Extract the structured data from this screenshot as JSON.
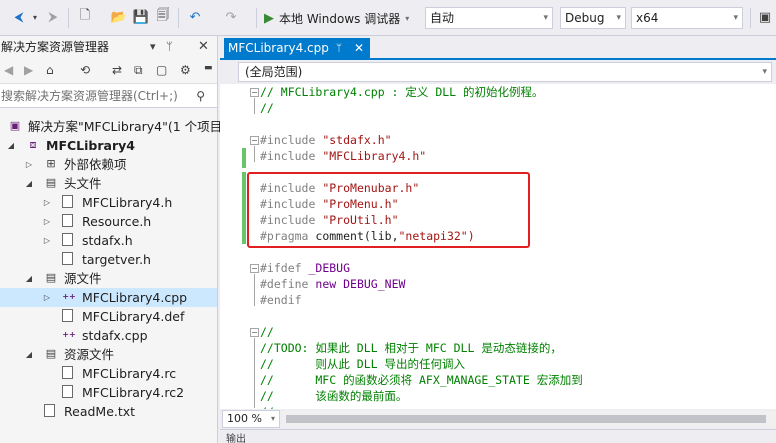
{
  "toolbar": {
    "run_label": "本地 Windows 调试器",
    "config_value": "自动",
    "build_config": "Debug",
    "platform": "x64"
  },
  "solution_explorer": {
    "title": "解决方案资源管理器",
    "search_placeholder": "搜索解决方案资源管理器(Ctrl+;)",
    "items": [
      {
        "label": "解决方案\"MFCLibrary4\"(1 个项目)",
        "icon": "solution-icon"
      },
      {
        "label": "MFCLibrary4",
        "icon": "project-icon",
        "bold": true
      },
      {
        "label": "外部依赖项",
        "icon": "dependencies-icon"
      },
      {
        "label": "头文件",
        "icon": "folder-icon"
      },
      {
        "label": "MFCLibrary4.h",
        "icon": "header-file-icon"
      },
      {
        "label": "Resource.h",
        "icon": "header-file-icon"
      },
      {
        "label": "stdafx.h",
        "icon": "header-file-icon"
      },
      {
        "label": "targetver.h",
        "icon": "header-file-icon"
      },
      {
        "label": "源文件",
        "icon": "folder-icon"
      },
      {
        "label": "MFCLibrary4.cpp",
        "icon": "cpp-file-icon"
      },
      {
        "label": "MFCLibrary4.def",
        "icon": "def-file-icon"
      },
      {
        "label": "stdafx.cpp",
        "icon": "cpp-file-icon"
      },
      {
        "label": "资源文件",
        "icon": "folder-icon"
      },
      {
        "label": "MFCLibrary4.rc",
        "icon": "rc-file-icon"
      },
      {
        "label": "MFCLibrary4.rc2",
        "icon": "rc-file-icon"
      },
      {
        "label": "ReadMe.txt",
        "icon": "text-file-icon"
      }
    ]
  },
  "editor": {
    "tab_label": "MFCLibrary4.cpp",
    "scope": "(全局范围)",
    "zoom": "100 %",
    "lines": [
      "// MFCLibrary4.cpp : 定义 DLL 的初始化例程。",
      "//",
      "",
      "#include \"stdafx.h\"",
      "#include \"MFCLibrary4.h\"",
      "",
      "#include \"ProMenubar.h\"",
      "#include \"ProMenu.h\"",
      "#include \"ProUtil.h\"",
      "#pragma comment(lib,\"netapi32\")",
      "",
      "#ifdef _DEBUG",
      "#define new DEBUG_NEW",
      "#endif",
      "",
      "//",
      "//TODO: 如果此 DLL 相对于 MFC DLL 是动态链接的，",
      "//      则从此 DLL 导出的任何调入",
      "//      MFC 的函数必须将 AFX_MANAGE_STATE 宏添加到",
      "//      该函数的最前面。",
      "//"
    ]
  },
  "bottom_panel": {
    "label": "输出"
  }
}
